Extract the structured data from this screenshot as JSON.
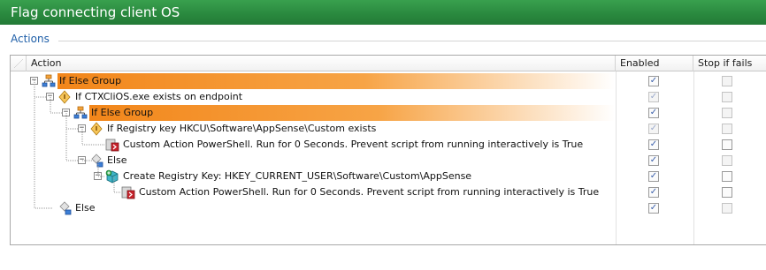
{
  "window": {
    "title": "Flag connecting client OS"
  },
  "section": {
    "label": "Actions"
  },
  "columns": {
    "action": "Action",
    "enabled": "Enabled",
    "stop": "Stop if fails"
  },
  "rows": [
    {
      "label": "If Else Group",
      "type": "group",
      "enabled": true,
      "stop": false,
      "enabled_dim": false,
      "stop_dim": true
    },
    {
      "label": "If CTXCliOS.exe exists on endpoint",
      "type": "condition",
      "enabled": true,
      "stop": false,
      "enabled_dim": true,
      "stop_dim": true
    },
    {
      "label": "If Else Group",
      "type": "group",
      "enabled": true,
      "stop": false,
      "enabled_dim": false,
      "stop_dim": true
    },
    {
      "label": "If Registry key HKCU\\Software\\AppSense\\Custom exists",
      "type": "condition",
      "enabled": true,
      "stop": false,
      "enabled_dim": true,
      "stop_dim": true
    },
    {
      "label": "Custom Action PowerShell. Run for 0 Seconds. Prevent script from running interactively is True",
      "type": "action",
      "enabled": true,
      "stop": false,
      "enabled_dim": false,
      "stop_dim": false
    },
    {
      "label": "Else",
      "type": "else",
      "enabled": true,
      "stop": false,
      "enabled_dim": false,
      "stop_dim": true
    },
    {
      "label": "Create Registry Key: HKEY_CURRENT_USER\\Software\\Custom\\AppSense",
      "type": "registry",
      "enabled": true,
      "stop": false,
      "enabled_dim": false,
      "stop_dim": false
    },
    {
      "label": "Custom Action PowerShell. Run for 0 Seconds. Prevent script from running interactively is True",
      "type": "action",
      "enabled": true,
      "stop": false,
      "enabled_dim": false,
      "stop_dim": false
    },
    {
      "label": "Else",
      "type": "else",
      "enabled": true,
      "stop": false,
      "enabled_dim": false,
      "stop_dim": true
    }
  ],
  "colors": {
    "title_bar": "#2a8a3f",
    "group_highlight": "#f2861a",
    "section_label": "#1f5fa8"
  }
}
